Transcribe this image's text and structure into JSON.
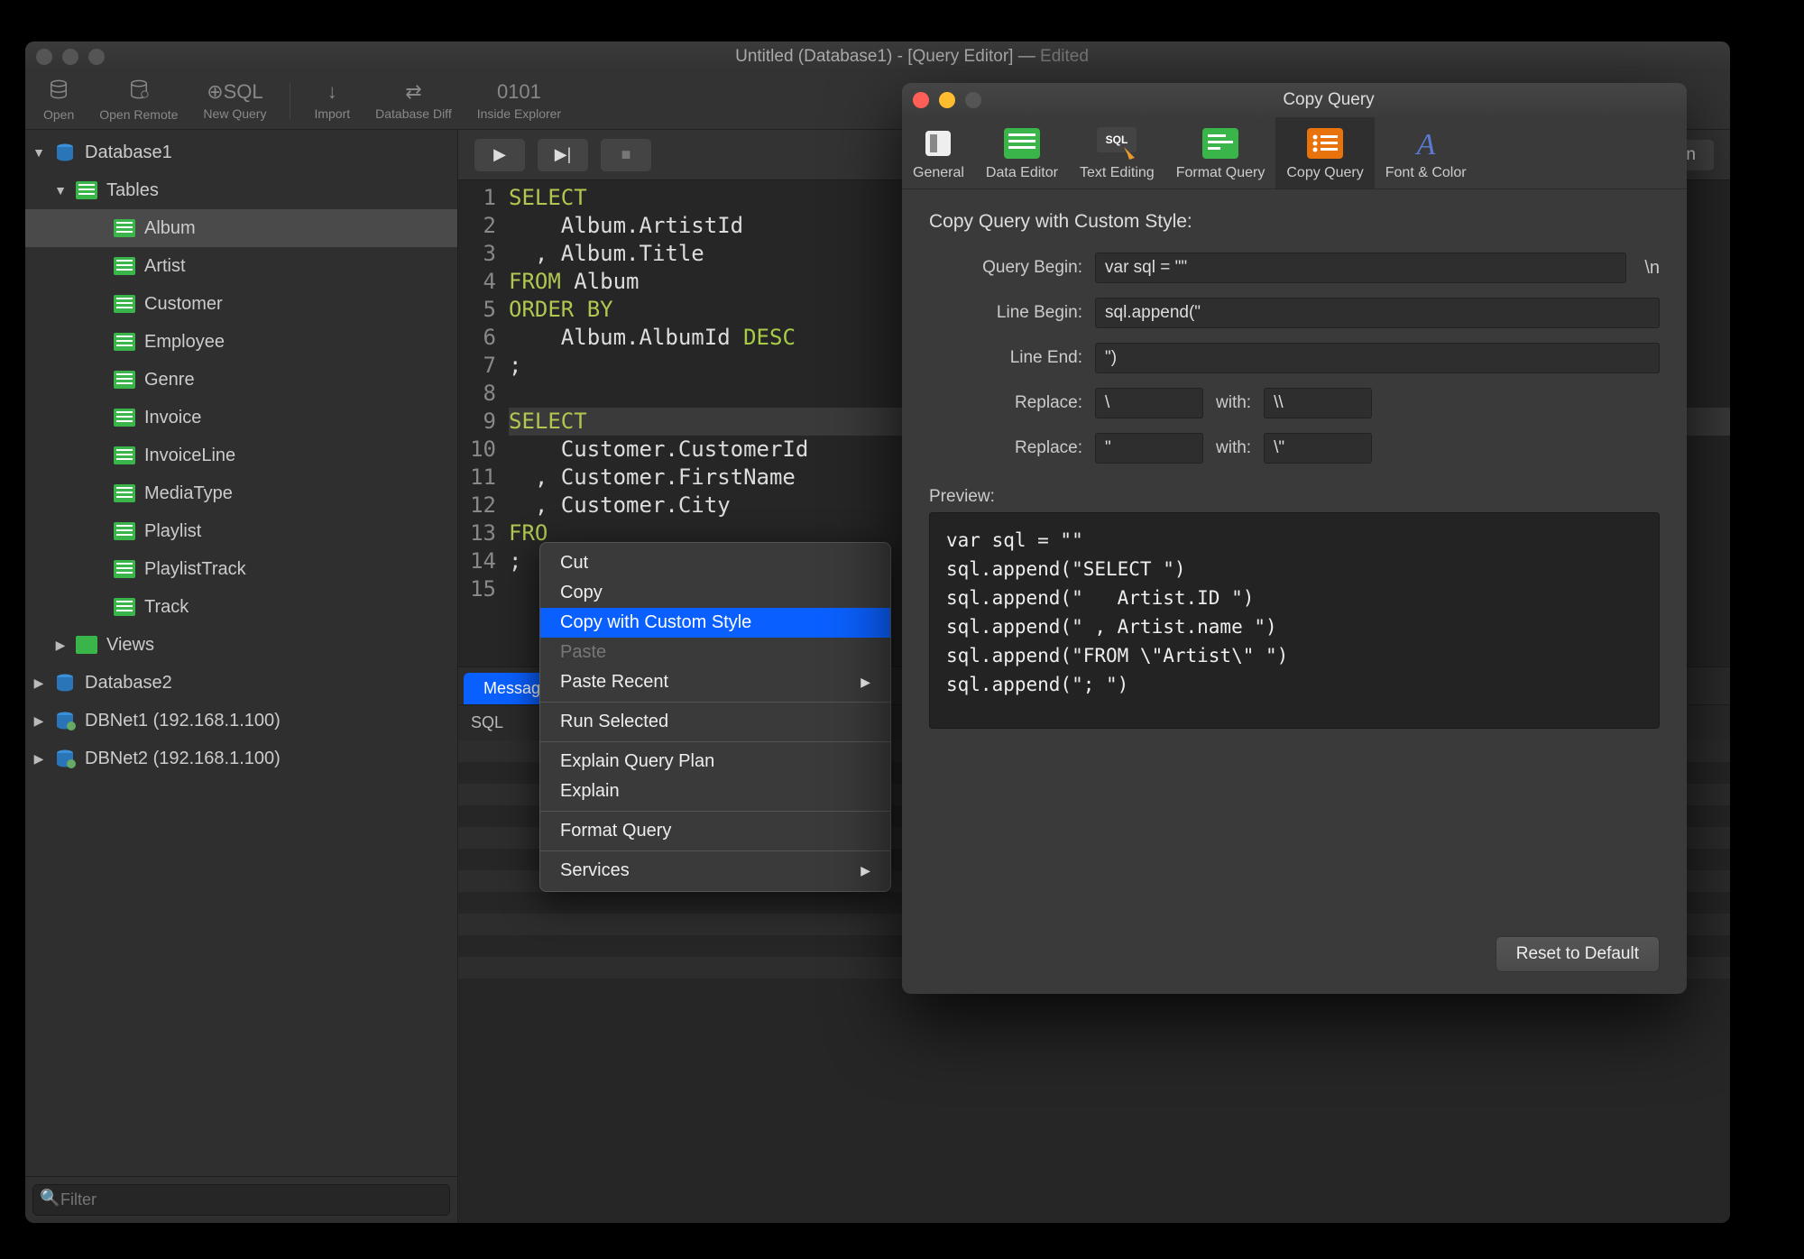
{
  "window": {
    "title_prefix": "Untitled (Database1) - [Query Editor] — ",
    "title_edited": "Edited"
  },
  "toolbar": {
    "open": "Open",
    "open_remote": "Open Remote",
    "new_query": "New Query",
    "sql_prefix": "⊕SQL",
    "import": "Import",
    "database_diff": "Database Diff",
    "inside_explorer": "Inside Explorer",
    "inside_explorer_icon_label": "0101"
  },
  "sidebar": {
    "db1": "Database1",
    "tables": "Tables",
    "items": [
      "Album",
      "Artist",
      "Customer",
      "Employee",
      "Genre",
      "Invoice",
      "InvoiceLine",
      "MediaType",
      "Playlist",
      "PlaylistTrack",
      "Track"
    ],
    "views": "Views",
    "db2": "Database2",
    "dbnet1": "DBNet1 (192.168.1.100)",
    "dbnet2": "DBNet2 (192.168.1.100)",
    "filter_placeholder": "Filter"
  },
  "editor": {
    "explain_button": "Explain Query Plan",
    "lines": [
      {
        "n": "1",
        "segs": [
          [
            "kw",
            "SELECT"
          ]
        ]
      },
      {
        "n": "2",
        "segs": [
          [
            "",
            "    Album.ArtistId"
          ]
        ]
      },
      {
        "n": "3",
        "segs": [
          [
            "",
            "  , Album.Title"
          ]
        ]
      },
      {
        "n": "4",
        "segs": [
          [
            "kw",
            "FROM"
          ],
          [
            "",
            " Album"
          ]
        ]
      },
      {
        "n": "5",
        "segs": [
          [
            "kw",
            "ORDER BY"
          ]
        ]
      },
      {
        "n": "6",
        "segs": [
          [
            "",
            "    Album.AlbumId "
          ],
          [
            "desc",
            "DESC"
          ]
        ]
      },
      {
        "n": "7",
        "segs": [
          [
            "",
            ";"
          ]
        ]
      },
      {
        "n": "8",
        "segs": [
          [
            "",
            ""
          ]
        ]
      },
      {
        "n": "9",
        "segs": [
          [
            "kw",
            "SELECT"
          ]
        ],
        "hl": true
      },
      {
        "n": "10",
        "segs": [
          [
            "",
            "    Customer.CustomerId"
          ]
        ]
      },
      {
        "n": "11",
        "segs": [
          [
            "",
            "  , Customer.FirstName"
          ]
        ]
      },
      {
        "n": "12",
        "segs": [
          [
            "",
            "  , Customer.City"
          ]
        ]
      },
      {
        "n": "13",
        "segs": [
          [
            "kw",
            "FRO"
          ]
        ]
      },
      {
        "n": "14",
        "segs": [
          [
            "",
            ";"
          ]
        ]
      },
      {
        "n": "15",
        "segs": [
          [
            "",
            ""
          ]
        ]
      }
    ],
    "tabs": {
      "messages": "Messages"
    },
    "results": {
      "sql": "SQL"
    }
  },
  "context_menu": {
    "cut": "Cut",
    "copy": "Copy",
    "copy_custom": "Copy with Custom Style",
    "paste": "Paste",
    "paste_recent": "Paste Recent",
    "run_selected": "Run Selected",
    "explain_plan": "Explain Query Plan",
    "explain": "Explain",
    "format": "Format Query",
    "services": "Services"
  },
  "dialog": {
    "title": "Copy Query",
    "tabs": {
      "general": "General",
      "data_editor": "Data Editor",
      "text_editing": "Text Editing",
      "format_query": "Format Query",
      "copy_query": "Copy Query",
      "font_color": "Font & Color"
    },
    "heading": "Copy Query with Custom Style:",
    "labels": {
      "query_begin": "Query Begin:",
      "line_begin": "Line Begin:",
      "line_end": "Line End:",
      "replace": "Replace:",
      "with": "with:"
    },
    "values": {
      "query_begin": "var sql = \"\"",
      "line_begin": "sql.append(\"",
      "line_end": "\")",
      "replace1_from": "\\",
      "replace1_to": "\\\\",
      "replace2_from": "\"",
      "replace2_to": "\\\""
    },
    "trail_newline": "\\n",
    "preview_label": "Preview:",
    "preview": "var sql = \"\"\nsql.append(\"SELECT \")\nsql.append(\"   Artist.ID \")\nsql.append(\" , Artist.name \")\nsql.append(\"FROM \\\"Artist\\\" \")\nsql.append(\"; \")",
    "reset": "Reset to Default"
  }
}
